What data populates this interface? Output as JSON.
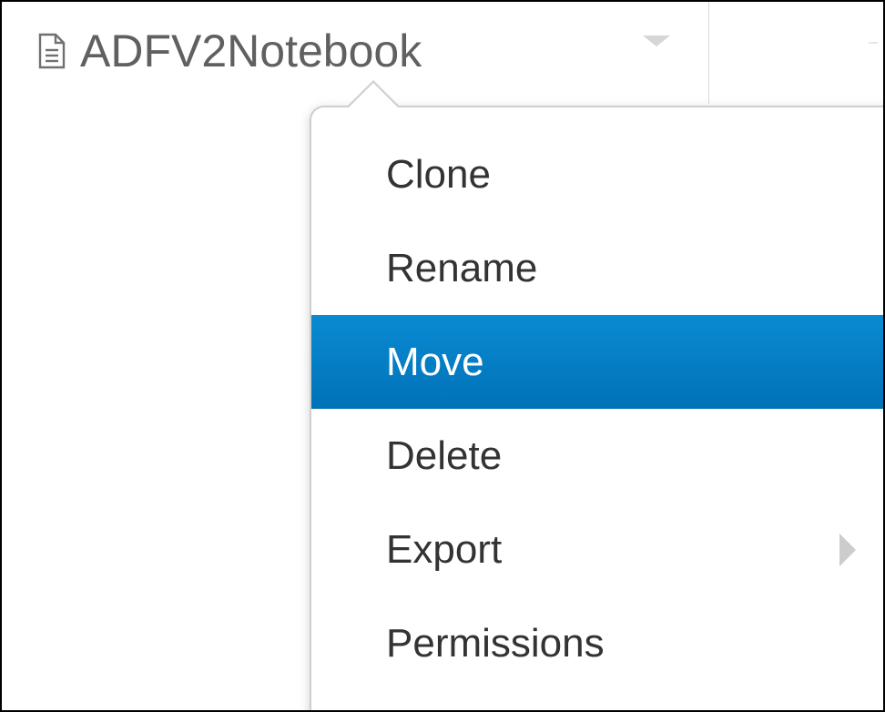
{
  "notebook": {
    "name": "ADFV2Notebook",
    "icon": "document-icon"
  },
  "menu": {
    "items": [
      {
        "label": "Clone",
        "active": false,
        "has_submenu": false
      },
      {
        "label": "Rename",
        "active": false,
        "has_submenu": false
      },
      {
        "label": "Move",
        "active": true,
        "has_submenu": false
      },
      {
        "label": "Delete",
        "active": false,
        "has_submenu": false
      },
      {
        "label": "Export",
        "active": false,
        "has_submenu": true
      },
      {
        "label": "Permissions",
        "active": false,
        "has_submenu": false
      }
    ]
  },
  "colors": {
    "highlight_top": "#0a8ad2",
    "highlight_bottom": "#0072b8",
    "text": "#333333",
    "title_text": "#606060"
  }
}
